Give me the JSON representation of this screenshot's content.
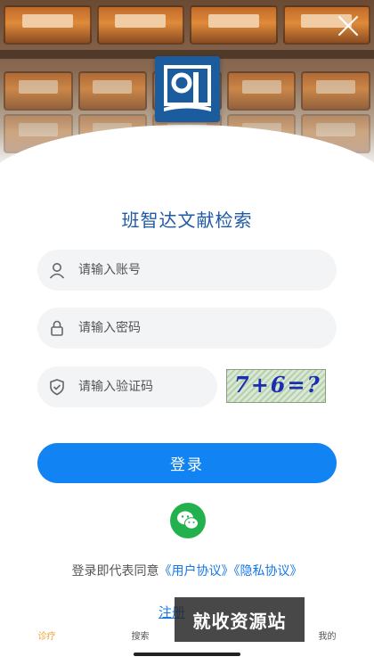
{
  "app": {
    "title": "班智达文献检索"
  },
  "login": {
    "account_placeholder": "请输入账号",
    "password_placeholder": "请输入密码",
    "captcha_placeholder": "请输入验证码",
    "captcha_text": "7+6=?",
    "submit_label": "登录"
  },
  "agreement": {
    "prefix": "登录即代表同意",
    "user_agreement": "《用户协议》",
    "privacy_policy": "《隐私协议》"
  },
  "register_label": "注册",
  "watermark": "就收资源站",
  "tabs": [
    {
      "label": "诊疗",
      "active": true
    },
    {
      "label": "搜索",
      "active": false
    },
    {
      "label": "",
      "active": false
    },
    {
      "label": "我的",
      "active": false
    }
  ],
  "colors": {
    "primary": "#1283f2",
    "title": "#1f5aa6",
    "wechat": "#23b14d",
    "tab_active": "#f0a030"
  },
  "icons": [
    "close-icon",
    "user-icon",
    "lock-icon",
    "shield-icon",
    "wechat-icon"
  ]
}
